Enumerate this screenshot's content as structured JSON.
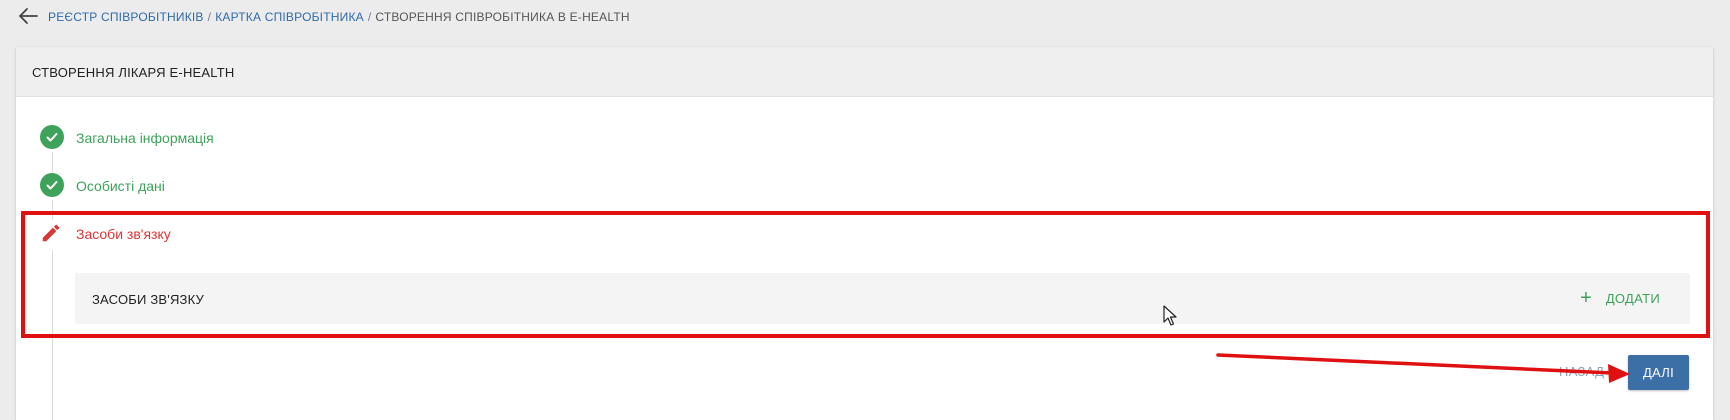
{
  "breadcrumb": {
    "items": [
      {
        "label": "РЕЄСТР СПІВРОБІТНИКІВ"
      },
      {
        "label": "КАРТКА СПІВРОБІТНИКА"
      },
      {
        "label": "СТВОРЕННЯ СПІВРОБІТНИКА В E-HEALTH"
      }
    ],
    "separator": "/"
  },
  "card": {
    "title": "СТВОРЕННЯ ЛІКАРЯ E-HEALTH"
  },
  "steps": [
    {
      "label": "Загальна інформація",
      "status": "done",
      "icon": "check-icon"
    },
    {
      "label": "Особисті дані",
      "status": "done",
      "icon": "check-icon"
    },
    {
      "label": "Засоби зв'язку",
      "status": "active",
      "icon": "pencil-icon"
    }
  ],
  "section": {
    "title": "ЗАСОБИ ЗВ'ЯЗКУ",
    "add_label": "ДОДАТИ",
    "add_icon": "plus-icon"
  },
  "actions": {
    "back_label": "НАЗАД",
    "next_label": "ДАЛІ"
  },
  "colors": {
    "success": "#3fa25a",
    "active": "#d93636",
    "primary": "#3b6fa6",
    "annotation": "#e01010"
  }
}
